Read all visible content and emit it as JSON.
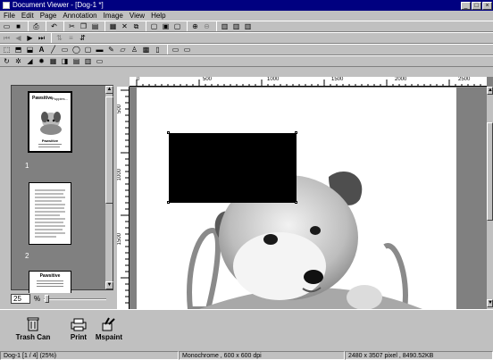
{
  "window": {
    "title": "Document Viewer - [Dog-1 *]"
  },
  "menu": [
    "File",
    "Edit",
    "Page",
    "Annotation",
    "Image",
    "View",
    "Help"
  ],
  "thumbnails": {
    "pages": [
      {
        "label": "1",
        "title": "Pawsitive",
        "subtitle": "Puppies...",
        "caption": "Pawsitive"
      },
      {
        "label": "2"
      },
      {
        "label": "",
        "title": "Pawsitive"
      }
    ]
  },
  "zoom": {
    "value": "25",
    "unit": "%"
  },
  "ruler": {
    "h_ticks": [
      "0",
      "500",
      "1000",
      "1500",
      "2000",
      "2500"
    ],
    "v_ticks": [
      "500",
      "1000",
      "1500"
    ]
  },
  "tools": [
    {
      "label": "Trash Can",
      "icon": "trash-can-icon"
    },
    {
      "label": "Print",
      "icon": "printer-icon"
    },
    {
      "label": "Mspaint",
      "icon": "paint-icon"
    }
  ],
  "status": {
    "doc": "Dog-1 [1 / 4] (25%)",
    "mode": "Monochrome , 600 x 600 dpi",
    "size": "2480 x 3507 pixel , 8490.52KB"
  },
  "colors": {
    "titlebar": "#000080",
    "face": "#c0c0c0",
    "workspace": "#808080"
  }
}
